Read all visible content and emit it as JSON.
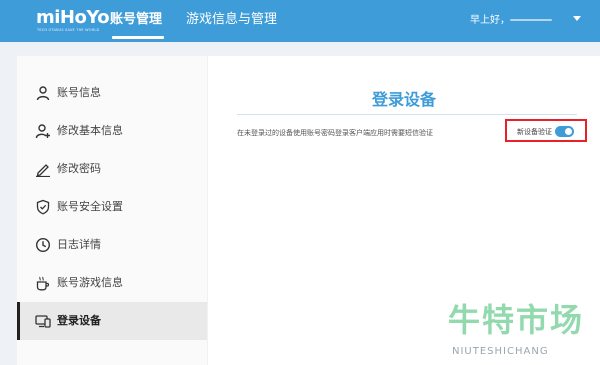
{
  "header": {
    "logo_text": "miHoYo",
    "logo_slogan": "TECH OTAKUS SAVE THE WORLD",
    "nav": [
      {
        "label": "账号管理",
        "active": true
      },
      {
        "label": "游戏信息与管理",
        "active": false
      }
    ],
    "greeting": "早上好，"
  },
  "sidebar": {
    "items": [
      {
        "label": "账号信息",
        "icon": "user-icon"
      },
      {
        "label": "修改基本信息",
        "icon": "user-edit-icon"
      },
      {
        "label": "修改密码",
        "icon": "pencil-icon"
      },
      {
        "label": "账号安全设置",
        "icon": "shield-check-icon"
      },
      {
        "label": "日志详情",
        "icon": "clock-icon"
      },
      {
        "label": "账号游戏信息",
        "icon": "cup-icon"
      },
      {
        "label": "登录设备",
        "icon": "devices-icon",
        "active": true
      }
    ]
  },
  "main": {
    "title": "登录设备",
    "description": "在未登录过的设备使用账号密码登录客户端应用时需要短信验证",
    "toggle_label": "新设备验证",
    "toggle_on": true
  },
  "watermark": {
    "main": "牛特市场",
    "sub": "NIUTESHICHANG"
  },
  "colors": {
    "accent": "#3e9cd9",
    "highlight": "#e8202a",
    "watermark": "#7fd3a1"
  }
}
